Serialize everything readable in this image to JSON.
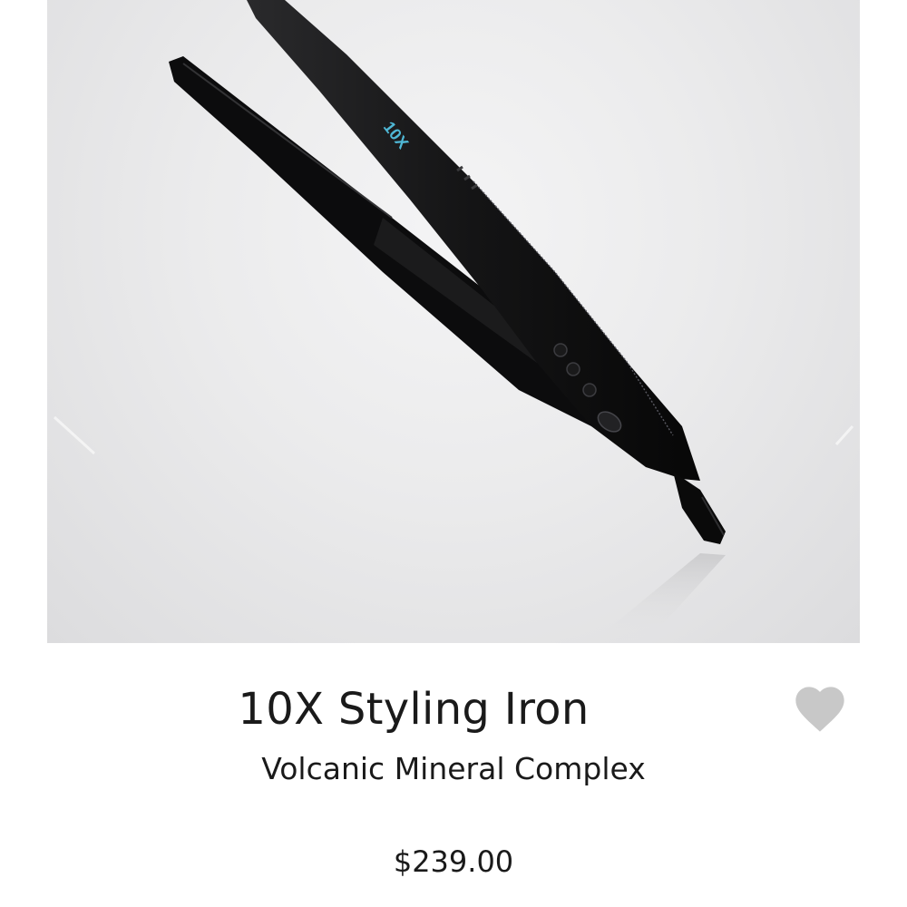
{
  "product": {
    "title": "10X Styling Iron",
    "subtitle": "Volcanic Mineral Complex",
    "price": "$239.00",
    "image_alt": "flat iron",
    "image_brand_text": "10X"
  },
  "favorite": {
    "icon": "heart-icon",
    "color": "#c8c8c8"
  },
  "colors": {
    "background": "#ffffff",
    "text": "#1a1a1a",
    "accent": "#4fb8d6"
  }
}
